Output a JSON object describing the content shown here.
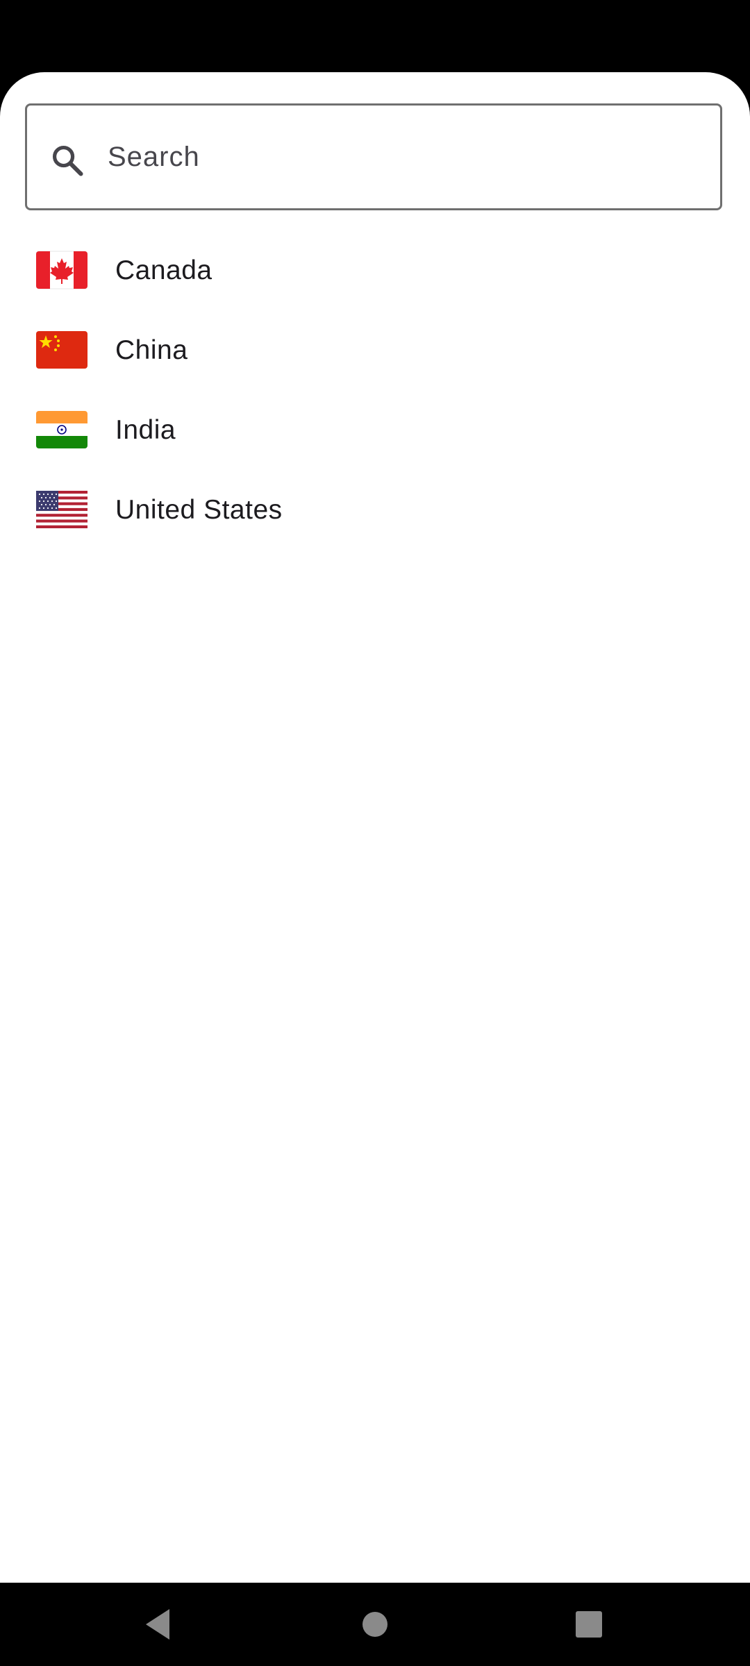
{
  "search": {
    "placeholder": "Search",
    "value": "",
    "icon": "search-icon"
  },
  "countries": [
    {
      "name": "Canada",
      "flag": "flag-canada-icon"
    },
    {
      "name": "China",
      "flag": "flag-china-icon"
    },
    {
      "name": "India",
      "flag": "flag-india-icon"
    },
    {
      "name": "United States",
      "flag": "flag-united-states-icon"
    }
  ],
  "navigation": {
    "back": "back-icon",
    "home": "home-icon",
    "recents": "recents-icon"
  },
  "colors": {
    "background": "#ffffff",
    "system_bars": "#000000",
    "text": "#1c1b1f",
    "outline": "#6f6f6f",
    "nav_buttons": "#8a8a8a"
  }
}
